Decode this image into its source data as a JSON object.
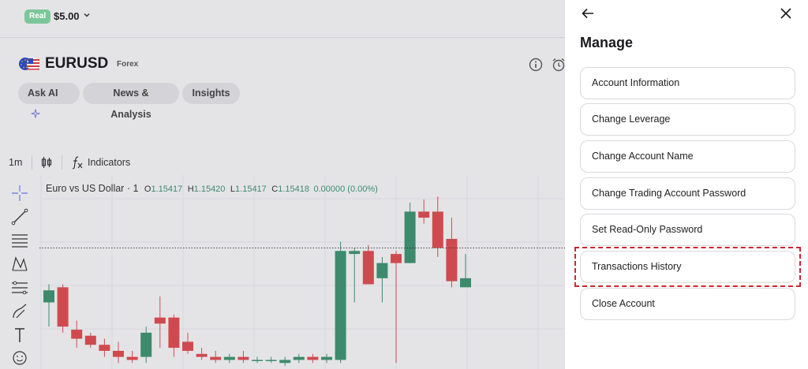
{
  "account": {
    "type_badge": "Real",
    "balance": "$5.00"
  },
  "instrument": {
    "symbol": "EURUSD",
    "market": "Forex",
    "tabs": [
      "Ask AI",
      "News & Analysis",
      "Insights"
    ]
  },
  "chart_toolbar": {
    "timeframe": "1m",
    "indicators_label": "Indicators"
  },
  "chart_legend": {
    "title": "Euro vs US Dollar · 1",
    "o_label": "O",
    "o_value": "1.15417",
    "h_label": "H",
    "h_value": "1.15420",
    "l_label": "L",
    "l_value": "1.15417",
    "c_label": "C",
    "c_value": "1.15418",
    "change": "0.00000 (0.00%)"
  },
  "colors": {
    "up": "#3e8a6c",
    "down": "#cf4a4f",
    "highlight": "#d3232f",
    "badge": "#7cc79a"
  },
  "panel": {
    "title": "Manage",
    "items": [
      "Account Information",
      "Change Leverage",
      "Change Account Name",
      "Change Trading Account Password",
      "Set Read-Only Password",
      "Transactions History",
      "Close Account"
    ],
    "highlighted_item": "Transactions History"
  },
  "chart_data": {
    "type": "candlestick",
    "candles": [
      {
        "o": 1.154,
        "h": 1.15406,
        "l": 1.15392,
        "c": 1.15404
      },
      {
        "o": 1.15405,
        "h": 1.15406,
        "l": 1.1539,
        "c": 1.15392
      },
      {
        "o": 1.15391,
        "h": 1.15394,
        "l": 1.15385,
        "c": 1.15388
      },
      {
        "o": 1.15389,
        "h": 1.1539,
        "l": 1.15385,
        "c": 1.15386
      },
      {
        "o": 1.15386,
        "h": 1.15388,
        "l": 1.15382,
        "c": 1.15384
      },
      {
        "o": 1.15384,
        "h": 1.15387,
        "l": 1.1538,
        "c": 1.15382
      },
      {
        "o": 1.15382,
        "h": 1.15384,
        "l": 1.1538,
        "c": 1.15381
      },
      {
        "o": 1.15382,
        "h": 1.15392,
        "l": 1.1538,
        "c": 1.1539
      },
      {
        "o": 1.15395,
        "h": 1.15402,
        "l": 1.15385,
        "c": 1.15393
      },
      {
        "o": 1.15395,
        "h": 1.15396,
        "l": 1.15382,
        "c": 1.15385
      },
      {
        "o": 1.15387,
        "h": 1.1539,
        "l": 1.15383,
        "c": 1.15384
      },
      {
        "o": 1.15383,
        "h": 1.15385,
        "l": 1.15381,
        "c": 1.15382
      },
      {
        "o": 1.15382,
        "h": 1.15384,
        "l": 1.1538,
        "c": 1.15381
      },
      {
        "o": 1.15381,
        "h": 1.15383,
        "l": 1.1538,
        "c": 1.15382
      },
      {
        "o": 1.15382,
        "h": 1.15384,
        "l": 1.1538,
        "c": 1.15381
      },
      {
        "o": 1.15381,
        "h": 1.15382,
        "l": 1.1538,
        "c": 1.15381
      },
      {
        "o": 1.15381,
        "h": 1.15382,
        "l": 1.1538,
        "c": 1.15381
      },
      {
        "o": 1.1538,
        "h": 1.15382,
        "l": 1.15379,
        "c": 1.15381
      },
      {
        "o": 1.15381,
        "h": 1.15383,
        "l": 1.1538,
        "c": 1.15382
      },
      {
        "o": 1.15382,
        "h": 1.15383,
        "l": 1.1538,
        "c": 1.15381
      },
      {
        "o": 1.15381,
        "h": 1.15383,
        "l": 1.1538,
        "c": 1.15382
      },
      {
        "o": 1.15381,
        "h": 1.1542,
        "l": 1.1538,
        "c": 1.15417
      },
      {
        "o": 1.15416,
        "h": 1.15418,
        "l": 1.154,
        "c": 1.15417
      },
      {
        "o": 1.15417,
        "h": 1.15419,
        "l": 1.15408,
        "c": 1.15406
      },
      {
        "o": 1.15408,
        "h": 1.15415,
        "l": 1.154,
        "c": 1.15413
      },
      {
        "o": 1.15416,
        "h": 1.15417,
        "l": 1.1538,
        "c": 1.15413
      },
      {
        "o": 1.15413,
        "h": 1.15433,
        "l": 1.15413,
        "c": 1.1543
      },
      {
        "o": 1.1543,
        "h": 1.15434,
        "l": 1.15426,
        "c": 1.15428
      },
      {
        "o": 1.1543,
        "h": 1.15435,
        "l": 1.15415,
        "c": 1.15418
      },
      {
        "o": 1.15421,
        "h": 1.15428,
        "l": 1.15405,
        "c": 1.15407
      },
      {
        "o": 1.15405,
        "h": 1.15416,
        "l": 1.15406,
        "c": 1.15408
      }
    ],
    "current_price": 1.15418
  }
}
